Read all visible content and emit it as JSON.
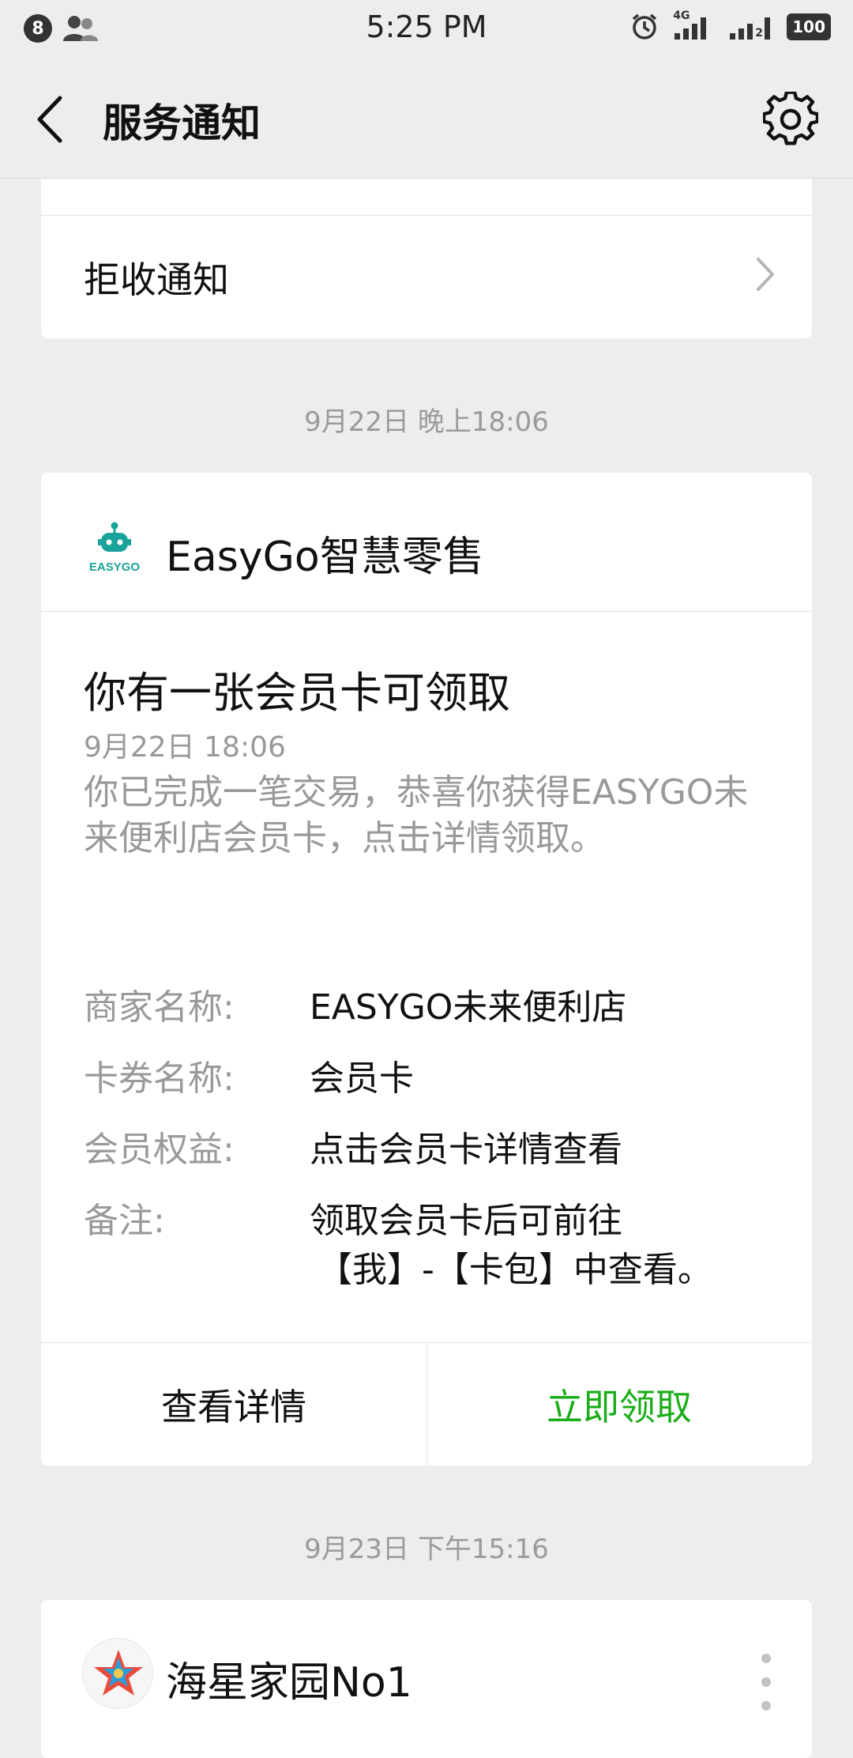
{
  "status_bar": {
    "notification_count": "8",
    "time": "5:25 PM",
    "network": "4G",
    "sim2": "2",
    "battery": "100"
  },
  "header": {
    "title": "服务通知"
  },
  "reject": {
    "label": "拒收通知"
  },
  "timestamps": [
    "9月22日 晚上18:06",
    "9月23日 下午15:16"
  ],
  "message": {
    "sender_name": "EasyGo智慧零售",
    "logo_text": "EASYGO",
    "title": "你有一张会员卡可领取",
    "date": "9月22日  18:06",
    "body": "你已完成一笔交易，恭喜你获得EASYGO未来便利店会员卡，点击详情领取。",
    "fields": [
      {
        "label": "商家名称:",
        "value": "EASYGO未来便利店"
      },
      {
        "label": "卡券名称:",
        "value": "会员卡"
      },
      {
        "label": "会员权益:",
        "value": "点击会员卡详情查看"
      },
      {
        "label": "备注:",
        "value_line1": "领取会员卡后可前往",
        "value_line2": "【我】-【卡包】中查看。"
      }
    ],
    "btn_detail": "查看详情",
    "btn_claim": "立即领取"
  },
  "next_message": {
    "sender_name": "海星家园No1"
  },
  "colors": {
    "accent_green": "#1aad19",
    "logo_teal": "#1aa39a"
  }
}
